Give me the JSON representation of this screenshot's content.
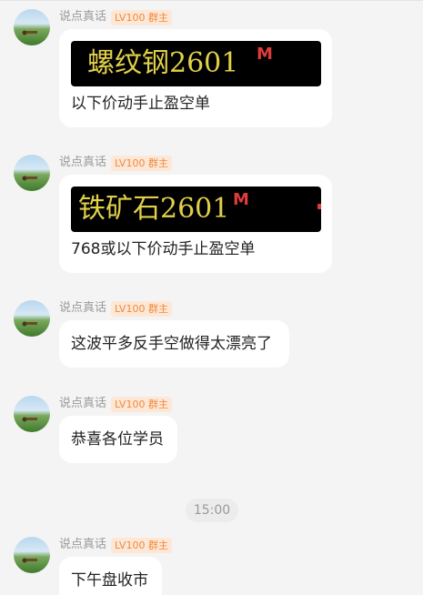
{
  "messages": [
    {
      "sender": "说点真话",
      "badge": "LV100 群主",
      "ticker": {
        "name": "螺纹钢2601",
        "flag": "M"
      },
      "text": "以下价动手止盈空单"
    },
    {
      "sender": "说点真话",
      "badge": "LV100 群主",
      "ticker": {
        "name": "铁矿石2601",
        "flag": "M"
      },
      "text": "768或以下价动手止盈空单"
    },
    {
      "sender": "说点真话",
      "badge": "LV100 群主",
      "text": "这波平多反手空做得太漂亮了"
    },
    {
      "sender": "说点真话",
      "badge": "LV100 群主",
      "text": "恭喜各位学员"
    },
    {
      "sender": "说点真话",
      "badge": "LV100 群主",
      "text": "下午盘收市"
    }
  ],
  "time_separator": "15:00",
  "colors": {
    "ticker_text": "#e0d04a",
    "ticker_flag": "#e23b3b",
    "badge_text": "#f0893a",
    "badge_bg": "#fde8d8"
  }
}
